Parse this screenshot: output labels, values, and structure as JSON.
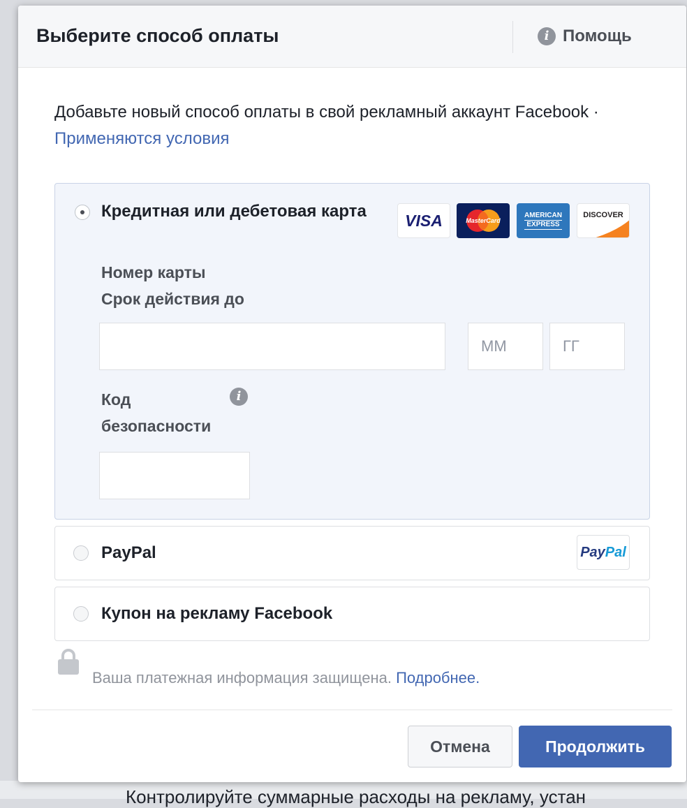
{
  "dialog": {
    "title": "Выберите способ оплаты",
    "help_label": "Помощь",
    "intro_text": "Добавьте новый способ оплаты в свой рекламный аккаунт Facebook · ",
    "terms_link": "Применяются условия"
  },
  "payment_options": {
    "card": {
      "label": "Кредитная или дебетовая карта",
      "selected": true,
      "card_number_label": "Номер карты",
      "expiry_label": "Срок действия до",
      "card_number_value": "",
      "month_placeholder": "ММ",
      "year_placeholder": "ГГ",
      "security_code_label_line1": "Код",
      "security_code_label_line2": "безопасности",
      "security_code_value": "",
      "logos": {
        "visa": "VISA",
        "mastercard": "MasterCard",
        "amex_line1": "AMERICAN",
        "amex_line2": "EXPRESS",
        "discover": "DISCOVER"
      }
    },
    "paypal": {
      "label": "PayPal",
      "logo_part1": "Pay",
      "logo_part2": "Pal"
    },
    "coupon": {
      "label": "Купон на рекламу Facebook"
    }
  },
  "security_note": {
    "text": "Ваша платежная информация защищена. ",
    "link": "Подробнее."
  },
  "buttons": {
    "cancel": "Отмена",
    "continue": "Продолжить"
  },
  "background_text": "Контролируйте суммарные расходы на рекламу, устан",
  "colors": {
    "brand_blue": "#4267b2",
    "selected_bg": "#f2f5fb"
  }
}
